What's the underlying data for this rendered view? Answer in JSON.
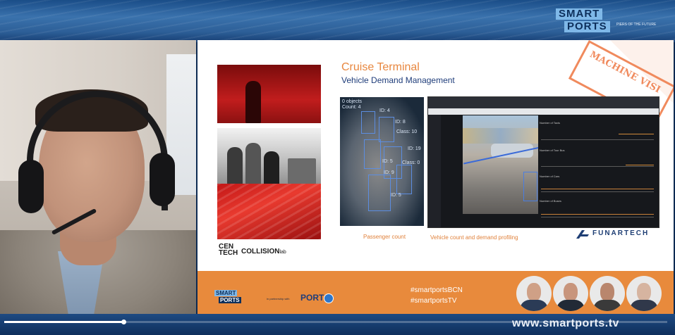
{
  "header": {
    "logo_top": "SMART",
    "logo_bottom": "PORTS",
    "logo_tagline": "PIERS OF THE FUTURE"
  },
  "slide": {
    "title": "Cruise Terminal",
    "subtitle": "Vehicle Demand Management",
    "stamp": "MACHINE VISI",
    "caption_passenger": "Passenger count",
    "caption_vehicle": "Vehicle count and demand profiling",
    "pax_overlay": [
      "0 objects",
      "Count: 4",
      "ID: 4",
      "ID: 8",
      "Class: 10",
      "ID: 19",
      "ID: 5",
      "Class: 0",
      "ID: 9",
      "ID: 5"
    ],
    "dash_graph_titles": [
      "Number of Taxis",
      "Number of Tour Bus",
      "Number of Cars",
      "Number of Buses"
    ],
    "dash_graph_titles_note": "",
    "logos": {
      "centech_top": "CEN",
      "centech_bottom": "TECH",
      "collision": "COLLISION",
      "collision_suffix": "lab",
      "funartech": "FUNARTECH"
    }
  },
  "footer": {
    "smartports_top": "SMART",
    "smartports_bottom": "PORTS",
    "partnership": "in partnership with",
    "port": "PORT",
    "hashtags": [
      "#smartportsBCN",
      "#smartportsTV"
    ]
  },
  "bottom_bar": {
    "url": "www.smartports.tv",
    "progress": 0.18
  },
  "colors": {
    "accent_orange": "#e88a3c",
    "title_orange": "#e8873f",
    "navy": "#1f3d7a"
  }
}
